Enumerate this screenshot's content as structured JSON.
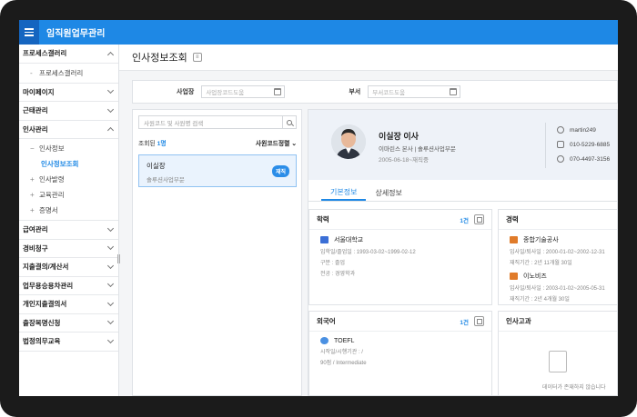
{
  "app": {
    "title": "임직원업무관리"
  },
  "sidebar": {
    "items": [
      {
        "label": "프로세스갤러리",
        "expanded": true
      },
      {
        "label": "마이페이지"
      },
      {
        "label": "근태관리"
      },
      {
        "label": "인사관리",
        "expanded": true
      },
      {
        "label": "급여관리"
      },
      {
        "label": "경비청구"
      },
      {
        "label": "지출결의/계산서"
      },
      {
        "label": "업무용승용차관리"
      },
      {
        "label": "개인지출결의서"
      },
      {
        "label": "출장복명신청"
      },
      {
        "label": "법정의무교육"
      }
    ],
    "gallery_sub": "프로세스갤러리",
    "hr_subs": [
      {
        "label": "인사정보",
        "prefix": "−"
      },
      {
        "label": "인사정보조회",
        "prefix": ""
      },
      {
        "label": "인사발령",
        "prefix": "+"
      },
      {
        "label": "교육관리",
        "prefix": "+"
      },
      {
        "label": "증명서",
        "prefix": "+"
      }
    ]
  },
  "page": {
    "title": "인사정보조회"
  },
  "filter": {
    "company_label": "사업장",
    "company_placeholder": "사업장코드도움",
    "dept_label": "부서",
    "dept_placeholder": "부서코드도움"
  },
  "employee_list": {
    "search_placeholder": "사원코드 및 사원명 검색",
    "count_label": "조회된",
    "count_value": "1명",
    "sort_label": "사원코드정렬",
    "items": [
      {
        "name": "이실장",
        "dept": "솔루션사업부문",
        "status": "재직"
      }
    ]
  },
  "profile": {
    "name": "이실장 이사",
    "dept": "이마린스 본사 | 솔루션사업부문",
    "join": "2005-06-18~재직중",
    "contacts": [
      {
        "icon": "user-icon",
        "value": "martin249"
      },
      {
        "icon": "mobile-icon",
        "value": "010-5229-6885"
      },
      {
        "icon": "phone-icon",
        "value": "070-4497-3156"
      }
    ]
  },
  "tabs": [
    {
      "label": "기본정보"
    },
    {
      "label": "상세정보"
    }
  ],
  "education": {
    "title": "학력",
    "count": "1건",
    "entries": [
      {
        "name": "서울대학교",
        "lines": [
          "입학일/졸업일 : 1993-03-02~1999-02-12",
          "구분 : 졸업",
          "전공 : 경영학과"
        ]
      }
    ]
  },
  "career": {
    "title": "경력",
    "entries": [
      {
        "name": "종합기술공사",
        "lines": [
          "입사일/퇴사일 : 2000-01-02~2002-12-31",
          "재직기간 : 2년 11개월 30일"
        ]
      },
      {
        "name": "이노비즈",
        "lines": [
          "입사일/퇴사일 : 2003-01-02~2005-05-31",
          "재직기간 : 2년 4개월 30일"
        ]
      }
    ]
  },
  "language": {
    "title": "외국어",
    "count": "1건",
    "entries": [
      {
        "name": "TOEFL",
        "lines": [
          "시작일/시행기관 :  /",
          "90점 / Intermediate"
        ]
      }
    ]
  },
  "evaluation": {
    "title": "인사고과",
    "empty_text": "데이터가 존재하지 않습니다"
  },
  "colors": {
    "accent": "#1e88e5",
    "topbar": "#1e88e5",
    "frame": "#1b1b1b"
  }
}
